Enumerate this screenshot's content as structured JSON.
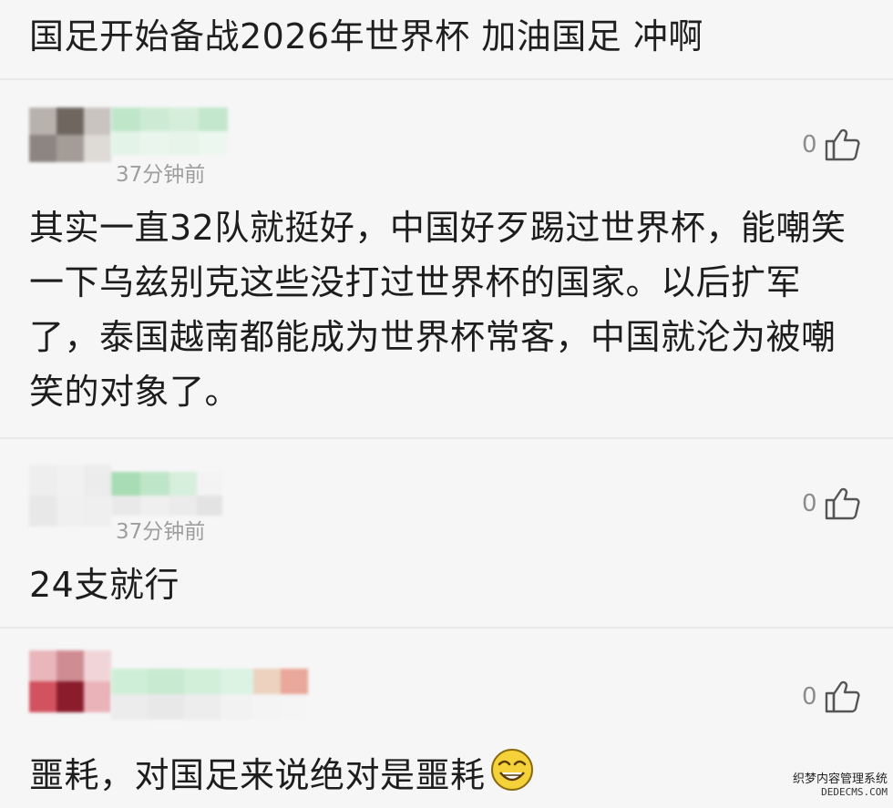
{
  "post": {
    "title": "国足开始备战2026年世界杯 加油国足 冲啊"
  },
  "comments": [
    {
      "timestamp": "37分钟前",
      "likes": "0",
      "text": "其实一直32队就挺好，中国好歹踢过世界杯，能嘲笑一下乌兹别克这些没打过世界杯的国家。以后扩军了，泰国越南都能成为世界杯常客，中国就沦为被嘲笑的对象了。"
    },
    {
      "timestamp": "37分钟前",
      "likes": "0",
      "text": "24支就行"
    },
    {
      "likes": "0",
      "text": "噩耗，对国足来说绝对是噩耗",
      "emoji": "grinning-face-icon"
    }
  ],
  "watermark": {
    "line1": "织梦内容管理系统",
    "line2": "DEDECMS.COM"
  },
  "colors": {
    "background": "#f6f6f6",
    "text": "#1d1d1d",
    "meta": "#9e9e9e",
    "divider": "#e8e8e8"
  }
}
